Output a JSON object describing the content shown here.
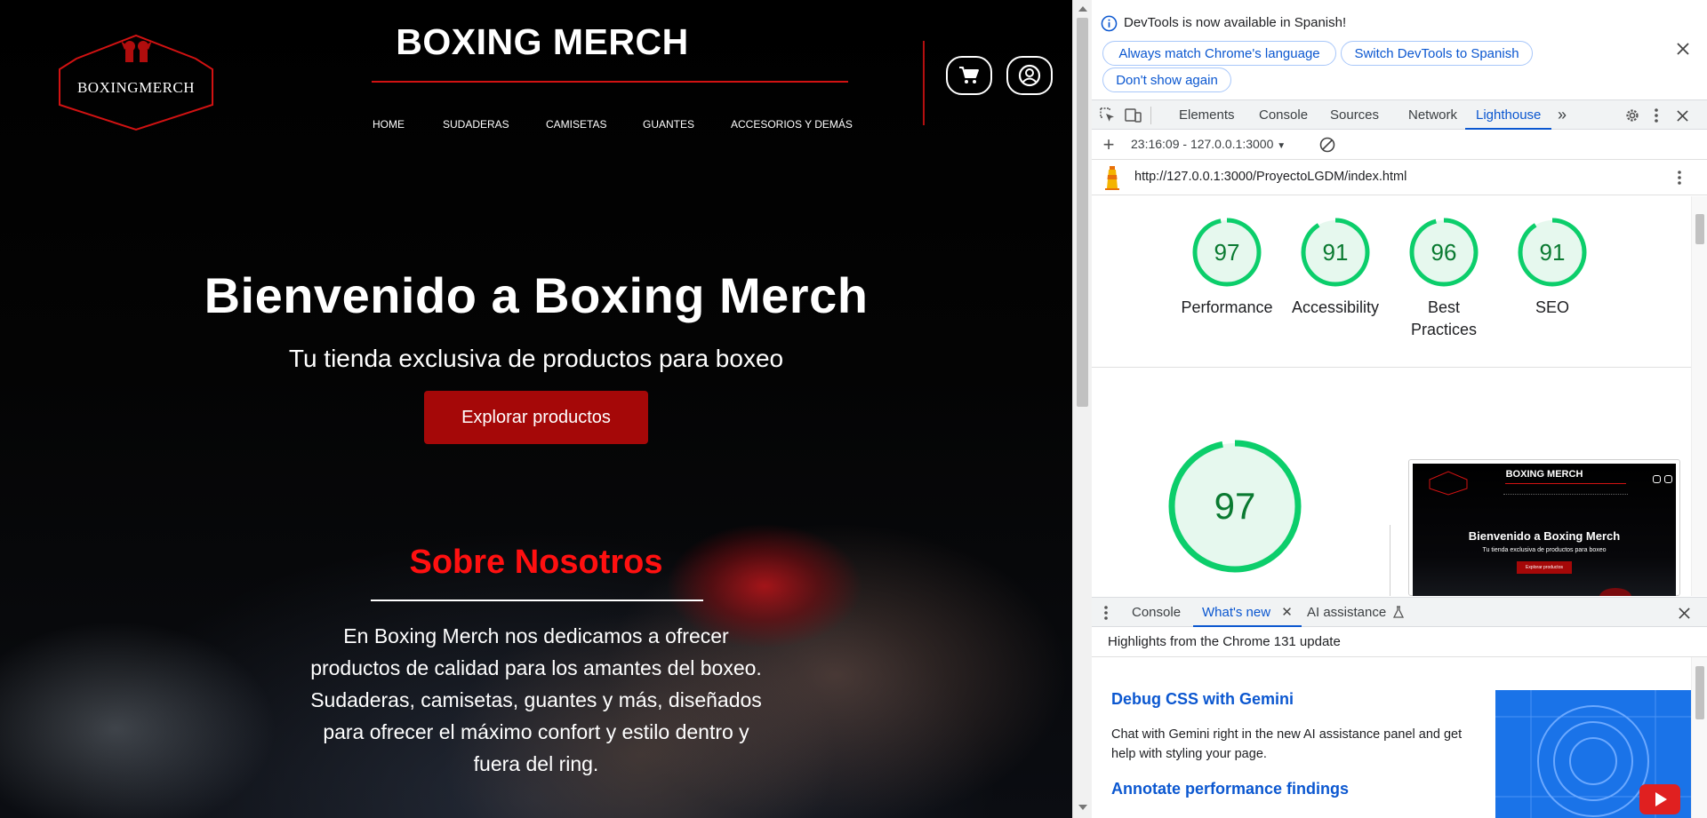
{
  "site": {
    "logo_text": "BOXINGMERCH",
    "title": "BOXING MERCH",
    "nav": [
      "HOME",
      "SUDADERAS",
      "CAMISETAS",
      "GUANTES",
      "ACCESORIOS Y DEMÁS"
    ],
    "hero_title": "Bienvenido a Boxing Merch",
    "hero_subtitle": "Tu tienda exclusiva de productos para boxeo",
    "cta_label": "Explorar productos",
    "about_title": "Sobre Nosotros",
    "about_lines": [
      "En Boxing Merch nos dedicamos a ofrecer",
      "productos de calidad para los amantes del boxeo.",
      "Sudaderas, camisetas, guantes y más, diseñados",
      "para ofrecer el máximo confort y estilo dentro y",
      "fuera del ring."
    ],
    "colors": {
      "accent_red": "#d11212",
      "cta_red": "#a50808",
      "about_title_red": "#ff1010"
    }
  },
  "devtools": {
    "infobar": {
      "message": "DevTools is now available in Spanish!",
      "btn_match": "Always match Chrome's language",
      "btn_switch": "Switch DevTools to Spanish",
      "btn_dont_show": "Don't show again"
    },
    "tabs": [
      "Elements",
      "Console",
      "Sources",
      "Network",
      "Lighthouse"
    ],
    "active_tab": "Lighthouse",
    "lighthouse": {
      "report_select": "23:16:09 - 127.0.0.1:3000",
      "url": "http://127.0.0.1:3000/ProyectoLGDM/index.html",
      "scores": [
        {
          "label": "Performance",
          "value": "97"
        },
        {
          "label": "Accessibility",
          "value": "91"
        },
        {
          "label": "Best Practices",
          "value": "96"
        },
        {
          "label": "SEO",
          "value": "91"
        }
      ],
      "big_score": "97",
      "thumb": {
        "title": "BOXING MERCH",
        "hero": "Bienvenido a Boxing Merch",
        "sub": "Tu tienda exclusiva de productos para boxeo",
        "btn": "Explorar productos"
      },
      "score_color": "#0cce6b"
    },
    "drawer": {
      "tabs": [
        "Console",
        "What's new",
        "AI assistance"
      ],
      "active_tab": "What's new",
      "subtitle": "Highlights from the Chrome 131 update",
      "items": [
        {
          "title": "Debug CSS with Gemini",
          "body": "Chat with Gemini right in the new AI assistance panel and get help with styling your page."
        },
        {
          "title": "Annotate performance findings",
          "body": ""
        }
      ]
    }
  }
}
